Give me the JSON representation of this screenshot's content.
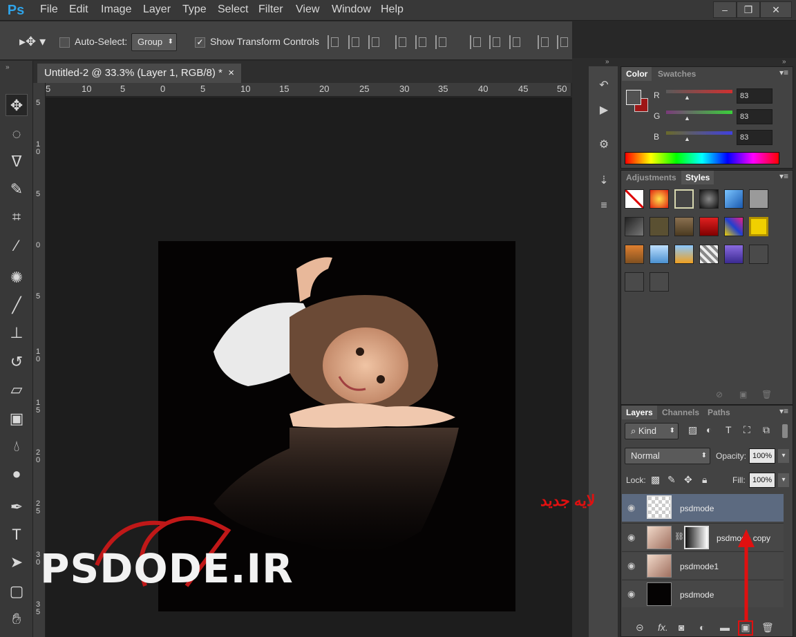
{
  "app": {
    "logo": "Ps",
    "menus": [
      "File",
      "Edit",
      "Image",
      "Layer",
      "Type",
      "Select",
      "Filter",
      "View",
      "Window",
      "Help"
    ],
    "window_controls": [
      "–",
      "❐",
      "✕"
    ]
  },
  "options": {
    "auto_select_label": "Auto-Select:",
    "auto_select_value": "Group",
    "show_transform_label": "Show Transform Controls"
  },
  "document": {
    "tab_title": "Untitled-2 @ 33.3% (Layer 1, RGB/8) *",
    "close": "×",
    "ruler_h": [
      "5",
      "10",
      "5",
      "0",
      "5",
      "10",
      "15",
      "20",
      "25",
      "30",
      "35",
      "40",
      "45",
      "50"
    ],
    "ruler_v": [
      "5",
      "1 0",
      "5",
      "0",
      "5",
      "1 0",
      "1 5",
      "2 0",
      "2 5",
      "3 0",
      "3 5"
    ]
  },
  "color_panel": {
    "tabs": [
      "Color",
      "Swatches"
    ],
    "channels": [
      {
        "label": "R",
        "value": "83"
      },
      {
        "label": "G",
        "value": "83"
      },
      {
        "label": "B",
        "value": "83"
      }
    ],
    "accent_fg": "#4a4a4a",
    "accent_bg": "#a01818"
  },
  "styles_panel": {
    "tabs": [
      "Adjustments",
      "Styles"
    ]
  },
  "layers_panel": {
    "tabs": [
      "Layers",
      "Channels",
      "Paths"
    ],
    "kind": "Kind",
    "blend_mode": "Normal",
    "opacity_label": "Opacity:",
    "opacity": "100%",
    "lock_label": "Lock:",
    "fill_label": "Fill:",
    "fill": "100%",
    "layers": [
      {
        "name": "psdmode",
        "selected": true
      },
      {
        "name": "psdmode copy",
        "selected": false
      },
      {
        "name": "psdmode1",
        "selected": false
      },
      {
        "name": "psdmode",
        "selected": false
      }
    ],
    "bottom_icons": [
      "link-icon",
      "fx-icon",
      "mask-icon",
      "adjustment-icon",
      "folder-icon",
      "new-layer-icon",
      "trash-icon"
    ]
  },
  "annotation": {
    "persian_label": "لایه جدید",
    "color": "#e01010"
  },
  "watermark": {
    "text": "PSDODE.IR"
  }
}
